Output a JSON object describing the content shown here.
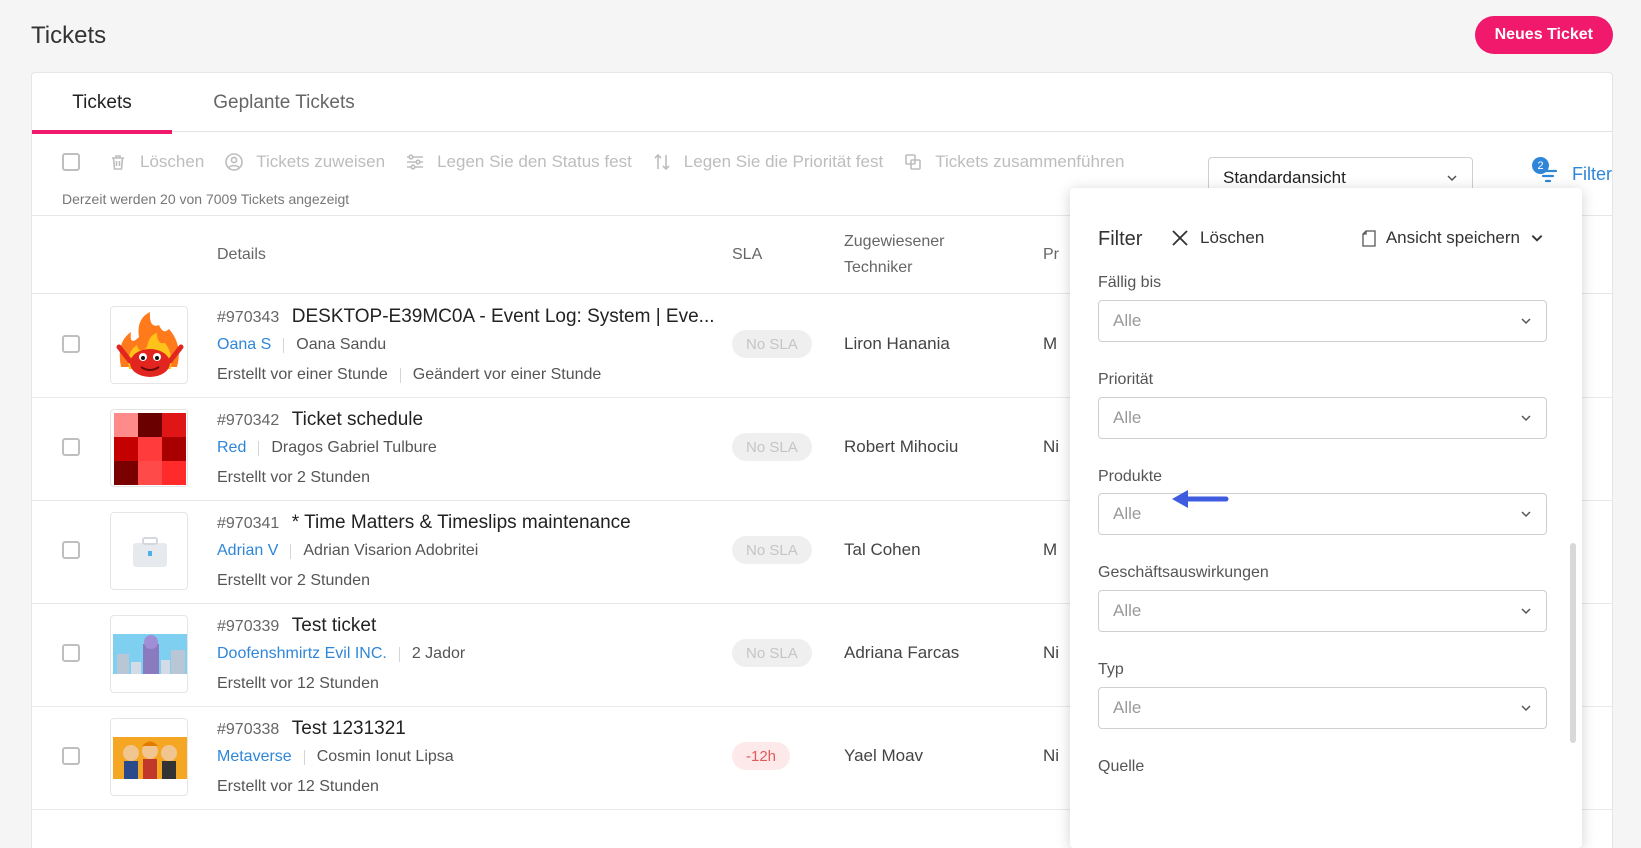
{
  "page": {
    "title": "Tickets",
    "new_ticket_label": "Neues Ticket"
  },
  "tabs": [
    {
      "label": "Tickets",
      "active": true
    },
    {
      "label": "Geplante Tickets",
      "active": false
    }
  ],
  "toolbar": {
    "delete": "Löschen",
    "assign": "Tickets zuweisen",
    "status": "Legen Sie den Status fest",
    "priority": "Legen Sie die Priorität fest",
    "merge": "Tickets zusammenführen",
    "count_text": "Derzeit werden 20 von 7009 Tickets angezeigt",
    "view": "Standardansicht",
    "filter_label": "Filter",
    "filter_count": "2"
  },
  "table": {
    "headers": {
      "details": "Details",
      "sla": "SLA",
      "tech_line1": "Zugewiesener",
      "tech_line2": "Techniker",
      "prio": "Pr"
    },
    "rows": [
      {
        "id": "#970343",
        "subject": "DESKTOP-E39MC0A - Event Log: System | Eve...",
        "company": "Oana S",
        "contact": "Oana Sandu",
        "created": "Erstellt vor einer Stunde",
        "changed": "Geändert vor einer Stunde",
        "sla": "No SLA",
        "sla_overdue": false,
        "tech": "Liron Hanania",
        "prio": "M",
        "thumb": "fire-monster-avatar"
      },
      {
        "id": "#970342",
        "subject": "Ticket schedule",
        "company": "Red",
        "contact": "Dragos Gabriel Tulbure",
        "created": "Erstellt vor 2 Stunden",
        "changed": "",
        "sla": "No SLA",
        "sla_overdue": false,
        "tech": "Robert Mihociu",
        "prio": "Ni",
        "thumb": "red-mosaic-avatar"
      },
      {
        "id": "#970341",
        "subject": "* Time Matters & Timeslips maintenance",
        "company": "Adrian V",
        "contact": "Adrian Visarion Adobritei",
        "created": "Erstellt vor 2 Stunden",
        "changed": "",
        "sla": "No SLA",
        "sla_overdue": false,
        "tech": "Tal Cohen",
        "prio": "M",
        "thumb": "toolbox-avatar"
      },
      {
        "id": "#970339",
        "subject": "Test ticket",
        "company": "Doofenshmirtz Evil INC.",
        "contact": "2 Jador",
        "created": "Erstellt vor 12 Stunden",
        "changed": "",
        "sla": "No SLA",
        "sla_overdue": false,
        "tech": "Adriana Farcas",
        "prio": "Ni",
        "thumb": "city-tower-avatar"
      },
      {
        "id": "#970338",
        "subject": "Test 1231321",
        "company": "Metaverse",
        "contact": "Cosmin Ionut Lipsa",
        "created": "Erstellt vor 12 Stunden",
        "changed": "",
        "sla": "-12h",
        "sla_overdue": true,
        "tech": "Yael Moav",
        "prio": "Ni",
        "thumb": "cartoon-group-avatar"
      }
    ]
  },
  "filter_panel": {
    "title": "Filter",
    "clear": "Löschen",
    "save_view": "Ansicht speichern",
    "fields": [
      {
        "label": "Fällig bis",
        "value": "Alle"
      },
      {
        "label": "Priorität",
        "value": "Alle"
      },
      {
        "label": "Produkte",
        "value": "Alle"
      },
      {
        "label": "Geschäftsauswirkungen",
        "value": "Alle"
      },
      {
        "label": "Typ",
        "value": "Alle"
      },
      {
        "label": "Quelle",
        "value": ""
      }
    ]
  },
  "colors": {
    "accent": "#f0196b",
    "link": "#2f86d9",
    "annotation_arrow": "#3f5ce0"
  }
}
